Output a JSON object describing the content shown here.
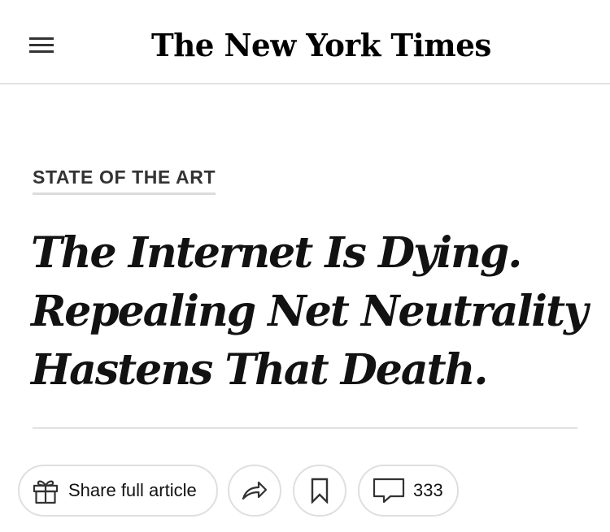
{
  "header": {
    "logo_text": "The New York Times",
    "menu_icon": "hamburger-menu-icon"
  },
  "article": {
    "kicker": "STATE OF THE ART",
    "headline_lines": [
      "The Internet Is Dying.",
      "Repealing Net Neutrality",
      "Hastens That Death."
    ]
  },
  "actions": {
    "share_label": "Share full article",
    "share_icon": "gift-icon",
    "forward_icon": "share-arrow-icon",
    "save_icon": "bookmark-icon",
    "comments_icon": "comment-bubble-icon",
    "comments_count": "333"
  },
  "colors": {
    "text": "#121212",
    "divider": "#e2e2e2",
    "pill_border": "#dfdfdf"
  }
}
